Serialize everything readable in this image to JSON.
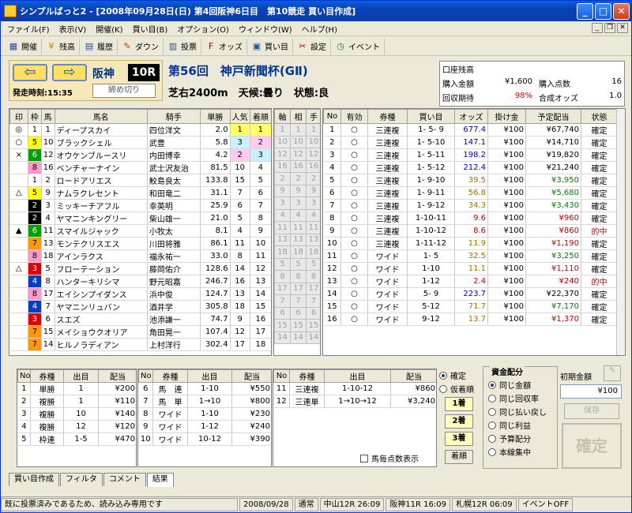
{
  "window": {
    "title": "シンプルばっと2 - [2008年09月28日(日) 第4回阪神6日目　第10競走 買い目作成]"
  },
  "menu": [
    "ファイル(F)",
    "表示(V)",
    "開催(K)",
    "買い目(B)",
    "オプション(O)",
    "ウィンドウ(W)",
    "ヘルプ(H)"
  ],
  "toolbar": [
    {
      "label": "開催",
      "icon": "calendar-icon"
    },
    {
      "label": "残高",
      "icon": "money-icon"
    },
    {
      "label": "履歴",
      "icon": "history-icon"
    },
    {
      "label": "ダウン",
      "icon": "download-icon"
    },
    {
      "label": "投票",
      "icon": "vote-icon"
    },
    {
      "label": "オッズ",
      "icon": "odds-icon"
    },
    {
      "label": "買い目",
      "icon": "ticket-icon"
    },
    {
      "label": "設定",
      "icon": "settings-icon"
    },
    {
      "label": "イベント",
      "icon": "clock-icon"
    }
  ],
  "race": {
    "venue": "阪神",
    "number": "10R",
    "start": "発走時刻:15:35",
    "close_btn": "締め切り",
    "title": "第56回　神戸新聞杯(GⅡ)",
    "info": "芝右2400m　天候:曇り　状態:良"
  },
  "summary": {
    "balance_label": "口座残高",
    "purchase_amount_label": "購入金額",
    "purchase_amount": "¥1,600",
    "purchase_count_label": "購入点数",
    "purchase_count": "16",
    "recovery_label": "回収期待",
    "recovery": "98%",
    "combined_odds_label": "合成オッズ",
    "combined_odds": "1.0"
  },
  "horse_headers": [
    "印",
    "枠",
    "馬",
    "馬名",
    "騎手",
    "単勝",
    "人気",
    "着順",
    "軸",
    "相",
    "手"
  ],
  "horses": [
    {
      "mark": "◎",
      "gate": "1",
      "no": "1",
      "name": "ディープスカイ",
      "jockey": "四位洋文",
      "odds": "2.0",
      "pop": "1",
      "fin": "1",
      "p": "1"
    },
    {
      "mark": "○",
      "gate": "5",
      "no": "10",
      "name": "ブラックシェル",
      "jockey": "武豊",
      "odds": "5.8",
      "pop": "3",
      "fin": "2",
      "p": "10"
    },
    {
      "mark": "×",
      "gate": "6",
      "no": "12",
      "name": "オウケンブルースリ",
      "jockey": "内田博幸",
      "odds": "4.2",
      "pop": "2",
      "fin": "3",
      "p": "12"
    },
    {
      "mark": "",
      "gate": "8",
      "no": "16",
      "name": "ベンチャーナイン",
      "jockey": "武士沢友治",
      "odds": "81.5",
      "pop": "10",
      "fin": "4",
      "p": "16"
    },
    {
      "mark": "",
      "gate": "1",
      "no": "2",
      "name": "ロードアリエス",
      "jockey": "鮫島良太",
      "odds": "133.8",
      "pop": "15",
      "fin": "5",
      "p": "2"
    },
    {
      "mark": "△",
      "gate": "5",
      "no": "9",
      "name": "ナムラクレセント",
      "jockey": "和田竜二",
      "odds": "31.1",
      "pop": "7",
      "fin": "6",
      "p": "9"
    },
    {
      "mark": "",
      "gate": "2",
      "no": "3",
      "name": "ミッキーチアフル",
      "jockey": "幸英明",
      "odds": "25.9",
      "pop": "6",
      "fin": "7",
      "p": "3"
    },
    {
      "mark": "",
      "gate": "2",
      "no": "4",
      "name": "ヤマニンキングリー",
      "jockey": "柴山雄一",
      "odds": "21.0",
      "pop": "5",
      "fin": "8",
      "p": "4"
    },
    {
      "mark": "▲",
      "gate": "6",
      "no": "11",
      "name": "スマイルジャック",
      "jockey": "小牧太",
      "odds": "8.1",
      "pop": "4",
      "fin": "9",
      "p": "11"
    },
    {
      "mark": "",
      "gate": "7",
      "no": "13",
      "name": "モンテクリスエス",
      "jockey": "川田将雅",
      "odds": "86.1",
      "pop": "11",
      "fin": "10",
      "p": "13"
    },
    {
      "mark": "",
      "gate": "8",
      "no": "18",
      "name": "アインラクス",
      "jockey": "福永祐一",
      "odds": "33.0",
      "pop": "8",
      "fin": "11",
      "p": "18"
    },
    {
      "mark": "△",
      "gate": "3",
      "no": "5",
      "name": "フローテーション",
      "jockey": "藤岡佑介",
      "odds": "128.6",
      "pop": "14",
      "fin": "12",
      "p": "5"
    },
    {
      "mark": "",
      "gate": "4",
      "no": "8",
      "name": "ハンターキリシマ",
      "jockey": "野元昭嘉",
      "odds": "246.7",
      "pop": "16",
      "fin": "13",
      "p": "8"
    },
    {
      "mark": "",
      "gate": "8",
      "no": "17",
      "name": "エイシンプイダンス",
      "jockey": "浜中俊",
      "odds": "124.7",
      "pop": "13",
      "fin": "14",
      "p": "17"
    },
    {
      "mark": "",
      "gate": "4",
      "no": "7",
      "name": "ヤマニンリュバン",
      "jockey": "酒井学",
      "odds": "305.8",
      "pop": "18",
      "fin": "15",
      "p": "7"
    },
    {
      "mark": "",
      "gate": "3",
      "no": "6",
      "name": "スエズ",
      "jockey": "池添謙一",
      "odds": "74.7",
      "pop": "9",
      "fin": "16",
      "p": "6"
    },
    {
      "mark": "",
      "gate": "7",
      "no": "15",
      "name": "メイショウクオリア",
      "jockey": "角田晃一",
      "odds": "107.4",
      "pop": "12",
      "fin": "17",
      "p": "15"
    },
    {
      "mark": "",
      "gate": "7",
      "no": "14",
      "name": "ヒルノラディアン",
      "jockey": "上村洋行",
      "odds": "302.4",
      "pop": "17",
      "fin": "18",
      "p": "14"
    }
  ],
  "bet_headers": [
    "No",
    "有効",
    "券種",
    "買い目",
    "オッズ",
    "掛け金",
    "予定配当",
    "状態"
  ],
  "bets": [
    {
      "no": "1",
      "valid": "○",
      "type": "三連複",
      "combo": "1- 5- 9",
      "odds": "677.4",
      "stake": "¥100",
      "payout": "¥67,740",
      "status": "確定"
    },
    {
      "no": "2",
      "valid": "○",
      "type": "三連複",
      "combo": "1- 5-10",
      "odds": "147.1",
      "stake": "¥100",
      "payout": "¥14,710",
      "status": "確定"
    },
    {
      "no": "3",
      "valid": "○",
      "type": "三連複",
      "combo": "1- 5-11",
      "odds": "198.2",
      "stake": "¥100",
      "payout": "¥19,820",
      "status": "確定"
    },
    {
      "no": "4",
      "valid": "○",
      "type": "三連複",
      "combo": "1- 5-12",
      "odds": "212.4",
      "stake": "¥100",
      "payout": "¥21,240",
      "status": "確定"
    },
    {
      "no": "5",
      "valid": "○",
      "type": "三連複",
      "combo": "1- 9-10",
      "odds": "39.5",
      "stake": "¥100",
      "payout": "¥3,950",
      "status": "確定"
    },
    {
      "no": "6",
      "valid": "○",
      "type": "三連複",
      "combo": "1- 9-11",
      "odds": "56.8",
      "stake": "¥100",
      "payout": "¥5,680",
      "status": "確定"
    },
    {
      "no": "7",
      "valid": "○",
      "type": "三連複",
      "combo": "1- 9-12",
      "odds": "34.3",
      "stake": "¥100",
      "payout": "¥3,430",
      "status": "確定"
    },
    {
      "no": "8",
      "valid": "○",
      "type": "三連複",
      "combo": "1-10-11",
      "odds": "9.6",
      "stake": "¥100",
      "payout": "¥960",
      "status": "確定"
    },
    {
      "no": "9",
      "valid": "○",
      "type": "三連複",
      "combo": "1-10-12",
      "odds": "8.6",
      "stake": "¥100",
      "payout": "¥860",
      "status": "的中"
    },
    {
      "no": "10",
      "valid": "○",
      "type": "三連複",
      "combo": "1-11-12",
      "odds": "11.9",
      "stake": "¥100",
      "payout": "¥1,190",
      "status": "確定"
    },
    {
      "no": "11",
      "valid": "○",
      "type": "ワイド",
      "combo": "1- 5",
      "odds": "32.5",
      "stake": "¥100",
      "payout": "¥3,250",
      "status": "確定"
    },
    {
      "no": "12",
      "valid": "○",
      "type": "ワイド",
      "combo": "1-10",
      "odds": "11.1",
      "stake": "¥100",
      "payout": "¥1,110",
      "status": "確定"
    },
    {
      "no": "13",
      "valid": "○",
      "type": "ワイド",
      "combo": "1-12",
      "odds": "2.4",
      "stake": "¥100",
      "payout": "¥240",
      "status": "的中"
    },
    {
      "no": "14",
      "valid": "○",
      "type": "ワイド",
      "combo": "5- 9",
      "odds": "223.7",
      "stake": "¥100",
      "payout": "¥22,370",
      "status": "確定"
    },
    {
      "no": "15",
      "valid": "○",
      "type": "ワイド",
      "combo": "5-12",
      "odds": "71.7",
      "stake": "¥100",
      "payout": "¥7,170",
      "status": "確定"
    },
    {
      "no": "16",
      "valid": "○",
      "type": "ワイド",
      "combo": "9-12",
      "odds": "13.7",
      "stake": "¥100",
      "payout": "¥1,370",
      "status": "確定"
    }
  ],
  "results_headers": [
    "No",
    "券種",
    "出目",
    "配当"
  ],
  "results1": [
    {
      "no": "1",
      "type": "単勝",
      "combo": "1",
      "pay": "¥200"
    },
    {
      "no": "2",
      "type": "複勝",
      "combo": "1",
      "pay": "¥110"
    },
    {
      "no": "3",
      "type": "複勝",
      "combo": "10",
      "pay": "¥140"
    },
    {
      "no": "4",
      "type": "複勝",
      "combo": "12",
      "pay": "¥120"
    },
    {
      "no": "5",
      "type": "枠連",
      "combo": "1-5",
      "pay": "¥470"
    }
  ],
  "results2": [
    {
      "no": "6",
      "type": "馬　連",
      "combo": "1-10",
      "pay": "¥550"
    },
    {
      "no": "7",
      "type": "馬　単",
      "combo": "1→10",
      "pay": "¥800"
    },
    {
      "no": "8",
      "type": "ワイド",
      "combo": "1-10",
      "pay": "¥230"
    },
    {
      "no": "9",
      "type": "ワイド",
      "combo": "1-12",
      "pay": "¥240"
    },
    {
      "no": "10",
      "type": "ワイド",
      "combo": "10-12",
      "pay": "¥390"
    }
  ],
  "results3": [
    {
      "no": "11",
      "type": "三連複",
      "combo": "1-10-12",
      "pay": "¥860"
    },
    {
      "no": "12",
      "type": "三連単",
      "combo": "1→10→12",
      "pay": "¥3,240"
    }
  ],
  "order": {
    "confirm": "確定",
    "tentative": "仮着順",
    "first": "1着",
    "second": "2着",
    "third": "3着",
    "finish_btn": "着順"
  },
  "per_horse": "馬毎点数表示",
  "fund": {
    "title": "資金配分",
    "options": [
      "同じ金額",
      "同じ回収率",
      "同じ払い戻し",
      "同じ利益",
      "予算配分",
      "本線集中"
    ],
    "initial_label": "初期金額",
    "initial": "¥100",
    "save": "保存",
    "confirm": "確定"
  },
  "tabs": [
    "買い目作成",
    "フィルタ",
    "コメント",
    "結果"
  ],
  "status": [
    "既に投票済みであるため、読み込み専用です",
    "2008/09/28",
    "通常",
    "中山12R 26:09",
    "阪神11R 16:09",
    "札幌12R 06:09",
    "イベントOFF"
  ],
  "colors": {
    "gate": {
      "1": "#ffffff",
      "2": "#000000",
      "3": "#e00000",
      "4": "#0040c0",
      "5": "#ffff00",
      "6": "#00a000",
      "7": "#ff9900",
      "8": "#ff99cc"
    }
  }
}
